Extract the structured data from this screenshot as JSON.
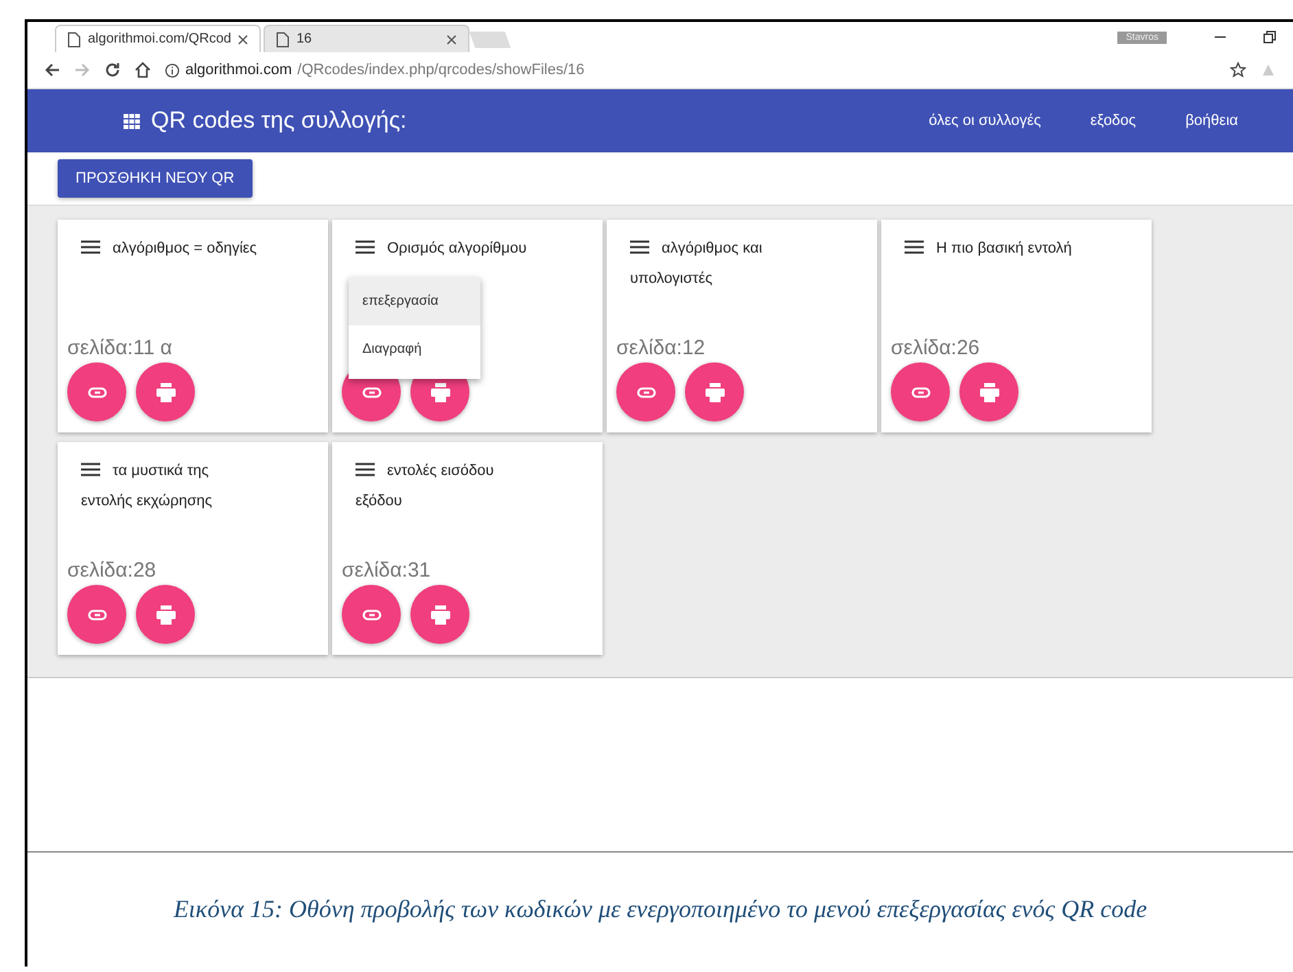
{
  "browser": {
    "tabs": [
      {
        "title": "algorithmoi.com/QRcod",
        "selected": true
      },
      {
        "title": "16",
        "selected": false
      }
    ],
    "user": "Stavros",
    "url_host": "algorithmoi.com",
    "url_path": "/QRcodes/index.php/qrcodes/showFiles/16"
  },
  "header": {
    "title": "QR codes της συλλογής:",
    "links": [
      "όλες οι συλλογές",
      "εξοδος",
      "βοήθεια"
    ]
  },
  "add_button": "ΠΡΟΣΘΗΚΗ ΝΕΟΥ QR",
  "cards": [
    {
      "title": "αλγόριθμος = οδηγίες",
      "page": "σελίδα:11 α",
      "menu_open": false
    },
    {
      "title": "Ορισμός αλγορίθμου",
      "menu_open": true
    },
    {
      "title": "αλγόριθμος και υπολογιστές",
      "page": "σελίδα:12",
      "menu_open": false
    },
    {
      "title": "Η πιο βασική εντολή",
      "page": "σελίδα:26",
      "menu_open": false
    },
    {
      "title": "τα μυστικά της εντολής εκχώρησης",
      "page": "σελίδα:28",
      "menu_open": false
    },
    {
      "title": "εντολές εισόδου εξόδου",
      "page": "σελίδα:31",
      "menu_open": false
    }
  ],
  "menu": [
    {
      "label": "επεξεργασία",
      "selected": true
    },
    {
      "label": "Διαγραφή",
      "selected": false
    }
  ],
  "caption": "Εικόνα 15: Οθόνη προβολής των κωδικών με ενεργοποιημένο το μενού επεξεργασίας ενός QR code"
}
